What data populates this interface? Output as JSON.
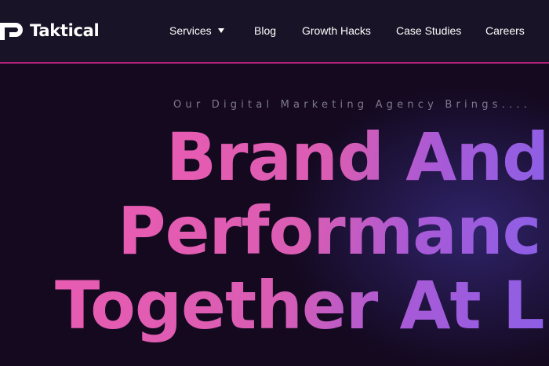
{
  "brand": {
    "name": "Taktical",
    "logo_icon": "tp-logo-mark"
  },
  "nav": {
    "services": "Services",
    "services_icon": "caret-down-icon",
    "blog": "Blog",
    "growth_hacks": "Growth Hacks",
    "case_studies": "Case Studies",
    "careers": "Careers"
  },
  "hero": {
    "tagline": "Our Digital Marketing Agency Brings....",
    "headline_line1": "Brand And",
    "headline_line2": "Performanc",
    "headline_line3": "Together At L"
  },
  "colors": {
    "background": "#14091f",
    "topbar": "#181326",
    "accent_border": "#b0237a",
    "gradient_start": "#e85cb2",
    "gradient_end": "#8c5fe6",
    "tagline": "#7e7a8f"
  }
}
